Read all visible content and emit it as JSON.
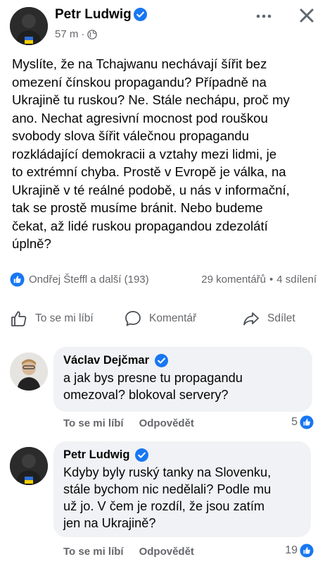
{
  "post": {
    "author": "Petr Ludwig",
    "time": "57 m",
    "separator": "·",
    "text": "Myslíte, že na Tchajwanu nechávají šířit bez\nomezení čínskou propagandu? Případně na\nUkrajině tu ruskou? Ne. Stále nechápu, proč my\nano. Nechat agresivní mocnost pod rouškou\nsvobody slova šířit válečnou propagandu\nrozkládající demokracii a vztahy mezi lidmi, je\nto extrémní chyba. Prostě v Evropě je válka, na\nUkrajině v té reálné podobě, u nás v informační,\ntak se prostě musíme bránit. Nebo budeme\nčekat, až lidé ruskou propagandou zdezolátí\núplně?",
    "reactors": "Ondřej Šteffl a další (193)",
    "comments_count": "29 komentářů",
    "dot": "•",
    "shares_count": "4 sdílení"
  },
  "actions": {
    "like": "To se mi líbí",
    "comment": "Komentář",
    "share": "Sdílet"
  },
  "comments": [
    {
      "author": "Václav Dejčmar",
      "text": "a jak bys presne tu propagandu\nomezoval? blokoval servery?",
      "like_label": "To se mi líbí",
      "reply_label": "Odpovědět",
      "likes": "5"
    },
    {
      "author": "Petr Ludwig",
      "text": "Kdyby byly ruský tanky na Slovenku,\nstále bychom nic nedělali? Podle mu\nuž jo. V čem je rozdíl, že jsou zatím\njen na Ukrajině?",
      "like_label": "To se mi líbí",
      "reply_label": "Odpovědět",
      "likes": "19"
    }
  ],
  "icons": {
    "verified": "verified-badge-icon",
    "globe": "globe-icon",
    "more": "more-dots-icon",
    "close": "close-icon",
    "like": "thumbs-up-icon",
    "comment": "comment-bubble-icon",
    "share": "share-arrow-icon",
    "reaction": "like-reaction-icon"
  },
  "colors": {
    "accent": "#1877f2",
    "secondary_text": "#65676b",
    "bubble": "#f0f2f5",
    "text": "#050505"
  }
}
